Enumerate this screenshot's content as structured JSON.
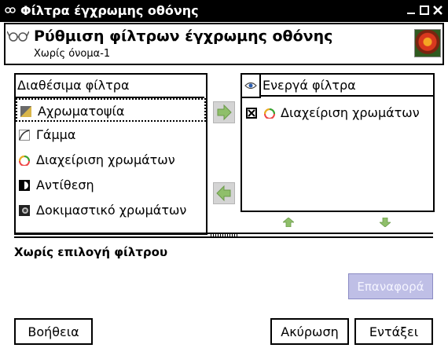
{
  "window": {
    "title": "Φίλτρα έγχρωμης οθόνης"
  },
  "header": {
    "title": "Ρύθμιση φίλτρων έγχρωμης οθόνης",
    "subtitle": "Χωρίς όνομα-1"
  },
  "available": {
    "column_label": "Διαθέσιμα φίλτρα",
    "items": [
      {
        "label": "Αχρωματοψία",
        "icon": "color-deficient-icon",
        "selected": true
      },
      {
        "label": "Γάμμα",
        "icon": "gamma-curve-icon",
        "selected": false
      },
      {
        "label": "Διαχείριση χρωμάτων",
        "icon": "color-wheel-icon",
        "selected": false
      },
      {
        "label": "Αντίθεση",
        "icon": "contrast-icon",
        "selected": false
      },
      {
        "label": "Δοκιμαστικό χρωμάτων",
        "icon": "proof-icon",
        "selected": false
      }
    ]
  },
  "active": {
    "column_label": "Ενεργά φίλτρα",
    "items": [
      {
        "label": "Διαχείριση χρωμάτων",
        "icon": "color-wheel-icon",
        "enabled": true
      }
    ]
  },
  "status": {
    "no_selection": "Χωρίς επιλογή φίλτρου"
  },
  "buttons": {
    "reset": "Επαναφορά",
    "help": "Βοήθεια",
    "cancel": "Ακύρωση",
    "ok": "Εντάξει"
  },
  "colors": {
    "titlebar": "#000000",
    "arrow_green": "#8fbf6a",
    "reset_bg": "#bfbfe6"
  }
}
